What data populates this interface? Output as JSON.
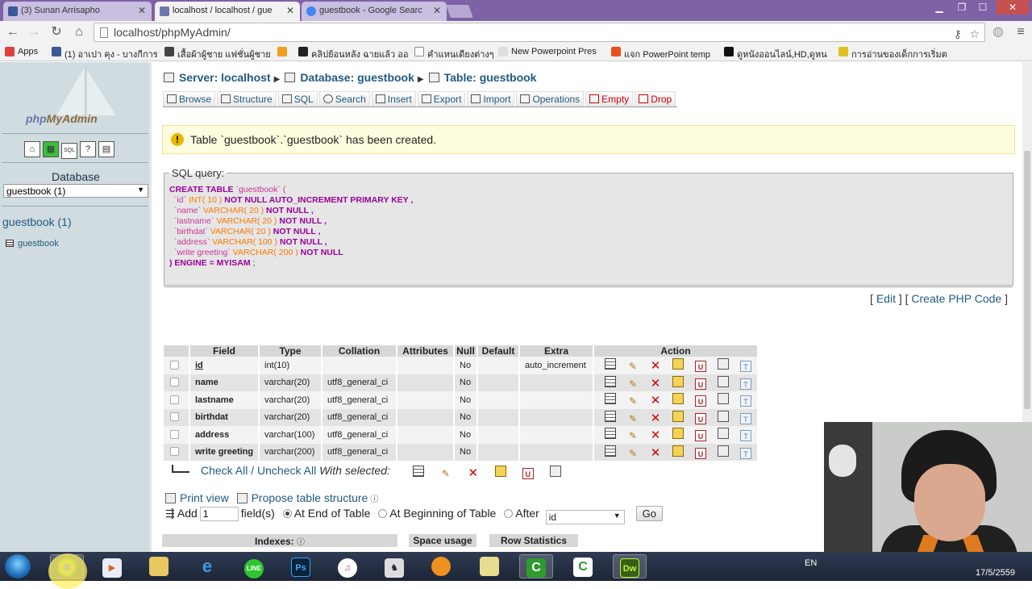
{
  "browser": {
    "tabs": [
      {
        "label": "(3) Sunan Arrisapho",
        "active": false,
        "icon_color": "#3b5998"
      },
      {
        "label": "localhost / localhost / gue",
        "active": true,
        "icon_color": "#6c78af"
      },
      {
        "label": "guestbook - Google Searc",
        "active": false,
        "icon_color": "#4285f4"
      }
    ],
    "url": "localhost/phpMyAdmin/",
    "bookmarks": [
      {
        "label": "Apps",
        "icon_color": "#e04040"
      },
      {
        "label": "(1) อาเปา คุง - บางกีการ",
        "icon_color": "#3b5998"
      },
      {
        "label": "เสื้อผ้าผู้ชาย แฟชั่นผู้ชาย",
        "icon_color": "#444444"
      },
      {
        "label": "",
        "icon_color": "#f0a020"
      },
      {
        "label": "คลิปย้อนหลัง ฉายแล้ว ออ",
        "icon_color": "#222222"
      },
      {
        "label": "คำแหนเดียงต่างๆ",
        "icon_color": "#dddddd"
      },
      {
        "label": "New Powerpoint Pres",
        "icon_color": "#cccccc"
      },
      {
        "label": "แจก PowerPoint temp",
        "icon_color": "#e8501a"
      },
      {
        "label": "ดูหนังออนไลน์,HD,ดูหน",
        "icon_color": "#111111"
      },
      {
        "label": "การอ่านของเด็กการเริ่มต",
        "icon_color": "#e0c020"
      }
    ]
  },
  "sidebar": {
    "logo": "phpMyAdmin",
    "logo_part1": "php",
    "logo_part2": "MyAdmin",
    "quick_icons": [
      "home-icon",
      "table-icon",
      "sql-icon",
      "docs-icon",
      "query-icon"
    ],
    "database_label": "Database",
    "database_select": "guestbook (1)",
    "db_link": "guestbook (1)",
    "table_link": "guestbook"
  },
  "breadcrumb": {
    "server": "Server: localhost",
    "database": "Database: guestbook",
    "table": "Table: guestbook"
  },
  "menu": {
    "browse": "Browse",
    "structure": "Structure",
    "sql": "SQL",
    "search": "Search",
    "insert": "Insert",
    "export": "Export",
    "import": "Import",
    "operations": "Operations",
    "empty": "Empty",
    "drop": "Drop"
  },
  "notice": "Table `guestbook`.`guestbook` has been created.",
  "sql_query": {
    "legend": "SQL query:",
    "lines": [
      {
        "kw": "CREATE TABLE",
        "rest": " `guestbook` ("
      },
      {
        "pre": "`id` ",
        "type": "INT",
        "args": "( 10 )",
        "post": " NOT NULL AUTO_INCREMENT PRIMARY KEY ,"
      },
      {
        "pre": "`name` ",
        "type": "VARCHAR",
        "args": "( 20 )",
        "post": " NOT NULL ,"
      },
      {
        "pre": "`lastname` ",
        "type": "VARCHAR",
        "args": "( 20 )",
        "post": " NOT NULL ,"
      },
      {
        "pre": "`birthdat` ",
        "type": "VARCHAR",
        "args": "( 20 )",
        "post": " NOT NULL ,"
      },
      {
        "pre": "`address` ",
        "type": "VARCHAR",
        "args": "( 100 )",
        "post": " NOT NULL ,"
      },
      {
        "pre": "`write greeting` ",
        "type": "VARCHAR",
        "args": "( 200 )",
        "post": " NOT NULL"
      },
      {
        "kw": ") ENGINE = MYISAM",
        "rest": " ;"
      }
    ],
    "edit_link": "Edit",
    "php_link": "Create PHP Code"
  },
  "structure": {
    "headers": [
      "",
      "Field",
      "Type",
      "Collation",
      "Attributes",
      "Null",
      "Default",
      "Extra",
      "Action"
    ],
    "rows": [
      {
        "field": "id",
        "type": "int(10)",
        "collation": "",
        "attributes": "",
        "null": "No",
        "default": "",
        "extra": "auto_increment",
        "primary": true
      },
      {
        "field": "name",
        "type": "varchar(20)",
        "collation": "utf8_general_ci",
        "attributes": "",
        "null": "No",
        "default": "",
        "extra": ""
      },
      {
        "field": "lastname",
        "type": "varchar(20)",
        "collation": "utf8_general_ci",
        "attributes": "",
        "null": "No",
        "default": "",
        "extra": ""
      },
      {
        "field": "birthdat",
        "type": "varchar(20)",
        "collation": "utf8_general_ci",
        "attributes": "",
        "null": "No",
        "default": "",
        "extra": ""
      },
      {
        "field": "address",
        "type": "varchar(100)",
        "collation": "utf8_general_ci",
        "attributes": "",
        "null": "No",
        "default": "",
        "extra": ""
      },
      {
        "field": "write greeting",
        "type": "varchar(200)",
        "collation": "utf8_general_ci",
        "attributes": "",
        "null": "No",
        "default": "",
        "extra": ""
      }
    ],
    "action_icons": [
      "browse-icon",
      "edit-icon",
      "drop-icon",
      "primary-key-icon",
      "unique-icon",
      "index-icon",
      "fulltext-icon"
    ]
  },
  "bulk": {
    "check_all": "Check All",
    "sep": " / ",
    "uncheck_all": "Uncheck All",
    "with_selected": "With selected:"
  },
  "print": {
    "print_view": "Print view",
    "propose": "Propose table structure"
  },
  "add_fields": {
    "label": "Add",
    "count": "1",
    "suffix": "field(s)",
    "at_end": "At End of Table",
    "at_beginning": "At Beginning of Table",
    "after": "After",
    "after_field": "id",
    "go": "Go"
  },
  "bottom": {
    "indexes": "Indexes:",
    "space_usage": "Space usage",
    "row_statistics": "Row Statistics"
  },
  "taskbar": {
    "apps": [
      "chrome",
      "media-player",
      "file-explorer",
      "internet-explorer",
      "line",
      "photoshop",
      "itunes",
      "game",
      "emoticon",
      "folder",
      "camtasia",
      "camtasia-2",
      "dreamweaver"
    ],
    "ps_label": "Ps",
    "dw_label": "Dw",
    "lang": "EN",
    "date": "17/5/2559"
  },
  "colors": {
    "link": "#235a81",
    "keyword": "#990099",
    "type": "#ff7700",
    "notice_bg": "#fffddf",
    "sidebar_bg": "#d0dce0"
  }
}
